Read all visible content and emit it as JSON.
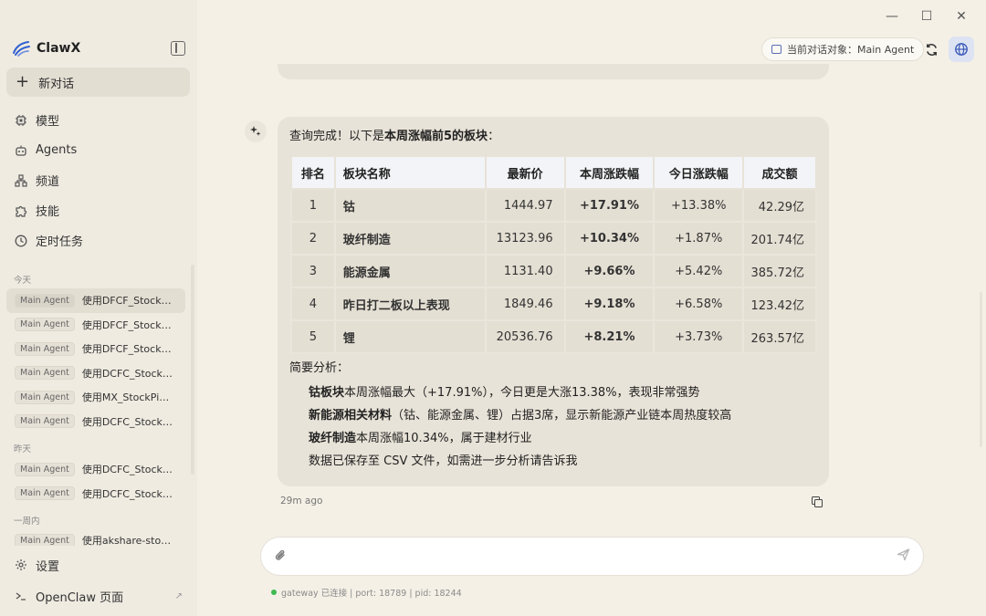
{
  "window": {
    "minimize": "—",
    "maximize": "☐",
    "close": "✕"
  },
  "app": {
    "name": "ClawX"
  },
  "sidebar": {
    "new_chat": "新对话",
    "nav": [
      {
        "label": "模型",
        "icon": "chip-icon"
      },
      {
        "label": "Agents",
        "icon": "robot-icon"
      },
      {
        "label": "频道",
        "icon": "network-icon"
      },
      {
        "label": "技能",
        "icon": "puzzle-icon"
      },
      {
        "label": "定时任务",
        "icon": "clock-icon"
      }
    ],
    "groups": [
      {
        "label": "今天",
        "sessions": [
          {
            "agent": "Main Agent",
            "title": "使用DFCF_Stock…"
          },
          {
            "agent": "Main Agent",
            "title": "使用DFCF_Stock…"
          },
          {
            "agent": "Main Agent",
            "title": "使用DFCF_Stock…"
          },
          {
            "agent": "Main Agent",
            "title": "使用DCFC_Stock…"
          },
          {
            "agent": "Main Agent",
            "title": "使用MX_StockPi…"
          },
          {
            "agent": "Main Agent",
            "title": "使用DCFC_Stock…"
          }
        ]
      },
      {
        "label": "昨天",
        "sessions": [
          {
            "agent": "Main Agent",
            "title": "使用DCFC_Stock…"
          },
          {
            "agent": "Main Agent",
            "title": "使用DCFC_Stock…"
          }
        ]
      },
      {
        "label": "一周内",
        "sessions": [
          {
            "agent": "Main Agent",
            "title": "使用akshare-sto…"
          }
        ]
      }
    ],
    "settings": "设置",
    "openclaw": "OpenClaw 页面"
  },
  "header": {
    "agent_chip": "当前对话对象：Main Agent"
  },
  "message": {
    "intro_prefix": "查询完成！以下是",
    "intro_bold": "本周涨幅前5的板块",
    "intro_suffix": "：",
    "table": {
      "headers": [
        "排名",
        "板块名称",
        "最新价",
        "本周涨跌幅",
        "今日涨跌幅",
        "成交额"
      ],
      "rows": [
        [
          "1",
          "钴",
          "1444.97",
          "+17.91%",
          "+13.38%",
          "42.29亿"
        ],
        [
          "2",
          "玻纤制造",
          "13123.96",
          "+10.34%",
          "+1.87%",
          "201.74亿"
        ],
        [
          "3",
          "能源金属",
          "1131.40",
          "+9.66%",
          "+5.42%",
          "385.72亿"
        ],
        [
          "4",
          "昨日打二板以上表现",
          "1849.46",
          "+9.18%",
          "+6.58%",
          "123.42亿"
        ],
        [
          "5",
          "锂",
          "20536.76",
          "+8.21%",
          "+3.73%",
          "263.57亿"
        ]
      ]
    },
    "analysis_title": "简要分析：",
    "analysis": [
      {
        "bold": "钴板块",
        "text": "本周涨幅最大（+17.91%），今日更是大涨13.38%，表现非常强势"
      },
      {
        "bold": "新能源相关材料",
        "text": "（钴、能源金属、锂）占据3席，显示新能源产业链本周热度较高"
      },
      {
        "bold": "玻纤制造",
        "text": "本周涨幅10.34%，属于建材行业"
      },
      {
        "bold": "",
        "text": "数据已保存至 CSV 文件，如需进一步分析请告诉我"
      }
    ],
    "timestamp": "29m ago"
  },
  "composer": {
    "placeholder": ""
  },
  "status": {
    "text": "gateway 已连接 | port: 18789 | pid: 18244",
    "color": "#3fb950"
  }
}
